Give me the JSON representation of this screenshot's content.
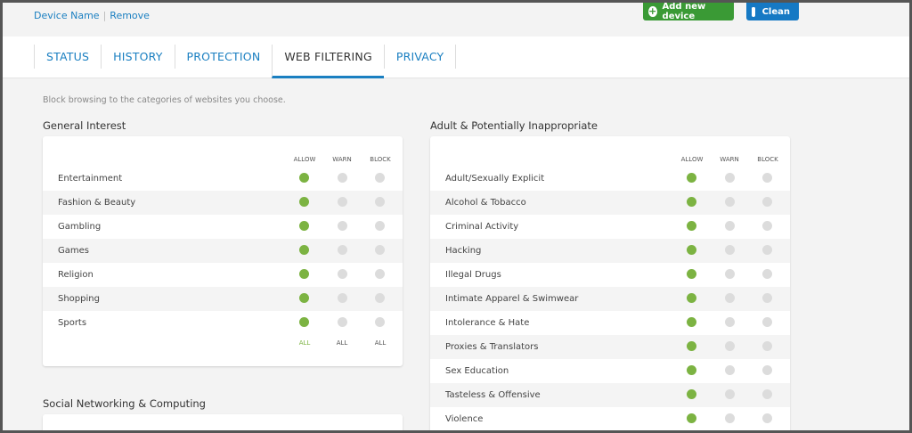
{
  "header": {
    "device_name": "Device Name",
    "remove": "Remove",
    "add_device": "Add new device",
    "clean": "Clean"
  },
  "tabs": [
    {
      "label": "STATUS"
    },
    {
      "label": "HISTORY"
    },
    {
      "label": "PROTECTION"
    },
    {
      "label": "WEB FILTERING",
      "active": true
    },
    {
      "label": "PRIVACY"
    }
  ],
  "description": "Block browsing to the categories of websites you choose.",
  "columns": {
    "allow": "ALLOW",
    "warn": "WARN",
    "block": "BLOCK"
  },
  "all_labels": {
    "allow": "ALL",
    "warn": "ALL",
    "block": "ALL"
  },
  "sections": {
    "general": {
      "title": "General Interest",
      "items": [
        {
          "label": "Entertainment",
          "setting": "allow"
        },
        {
          "label": "Fashion & Beauty",
          "setting": "allow"
        },
        {
          "label": "Gambling",
          "setting": "allow"
        },
        {
          "label": "Games",
          "setting": "allow"
        },
        {
          "label": "Religion",
          "setting": "allow"
        },
        {
          "label": "Shopping",
          "setting": "allow"
        },
        {
          "label": "Sports",
          "setting": "allow"
        }
      ]
    },
    "adult": {
      "title": "Adult & Potentially Inappropriate",
      "items": [
        {
          "label": "Adult/Sexually Explicit",
          "setting": "allow"
        },
        {
          "label": "Alcohol & Tobacco",
          "setting": "allow"
        },
        {
          "label": "Criminal Activity",
          "setting": "allow"
        },
        {
          "label": "Hacking",
          "setting": "allow"
        },
        {
          "label": "Illegal Drugs",
          "setting": "allow"
        },
        {
          "label": "Intimate Apparel & Swimwear",
          "setting": "allow"
        },
        {
          "label": "Intolerance & Hate",
          "setting": "allow"
        },
        {
          "label": "Proxies & Translators",
          "setting": "allow"
        },
        {
          "label": "Sex Education",
          "setting": "allow"
        },
        {
          "label": "Tasteless & Offensive",
          "setting": "allow"
        },
        {
          "label": "Violence",
          "setting": "allow"
        }
      ]
    },
    "social": {
      "title": "Social Networking & Computing"
    }
  },
  "colors": {
    "accent": "#1a7fc1",
    "allow_on": "#7cb342",
    "off": "#dcdcdc",
    "add_btn": "#3a9a35",
    "clean_btn": "#1679c4"
  }
}
